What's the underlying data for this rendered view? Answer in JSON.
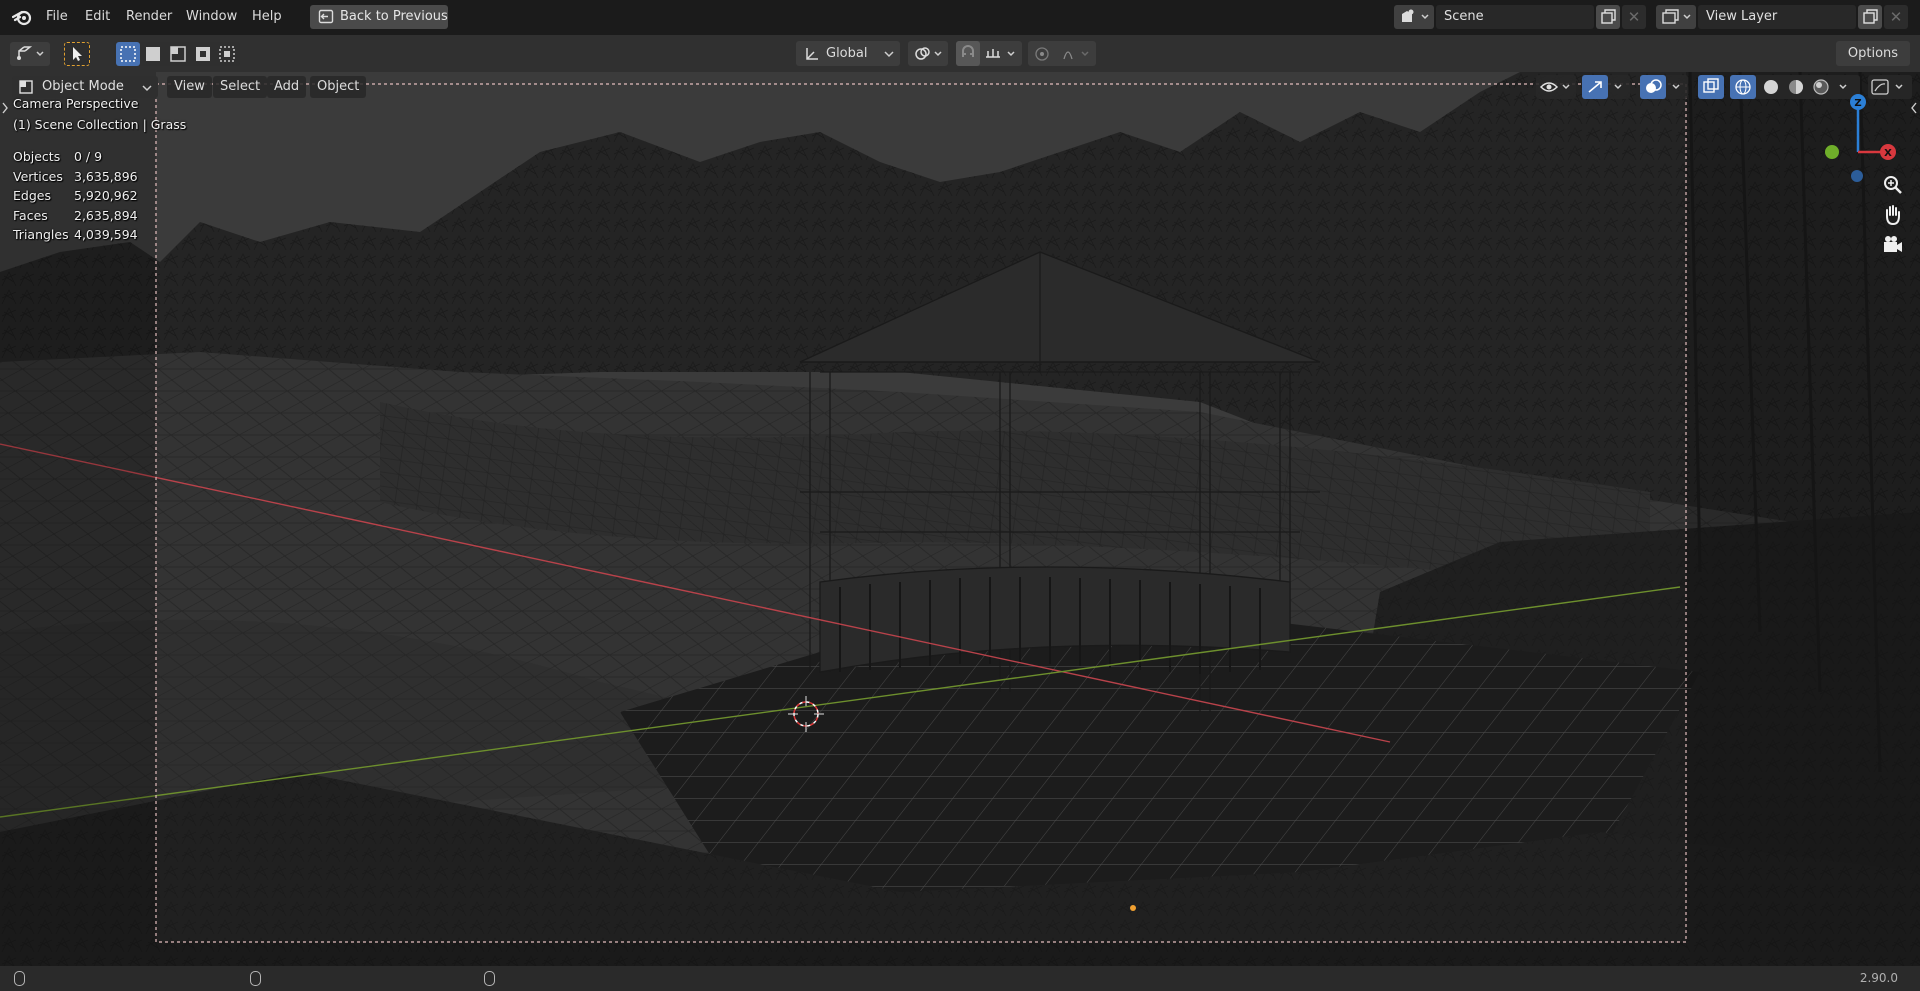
{
  "menubar": {
    "items": [
      "File",
      "Edit",
      "Render",
      "Window",
      "Help"
    ],
    "back_button": "Back to Previous",
    "scene_name": "Scene",
    "view_layer_name": "View Layer"
  },
  "toolbar": {
    "orientation": "Global",
    "options_label": "Options"
  },
  "viewport": {
    "mode": "Object Mode",
    "menus": [
      "View",
      "Select",
      "Add",
      "Object"
    ],
    "overlay_title": "Camera Perspective",
    "overlay_collection": "(1) Scene Collection | Grass",
    "stats": [
      {
        "label": "Objects",
        "value": "0 / 9"
      },
      {
        "label": "Vertices",
        "value": "3,635,896"
      },
      {
        "label": "Edges",
        "value": "5,920,962"
      },
      {
        "label": "Faces",
        "value": "2,635,894"
      },
      {
        "label": "Triangles",
        "value": "4,039,594"
      }
    ],
    "gizmo": {
      "z_label": "Z",
      "x_label": "X"
    }
  },
  "statusbar": {
    "version": "2.90.0"
  },
  "colors": {
    "x_axis": "#b8424a",
    "y_axis": "#6d8f2d",
    "gizmo_z": "#2b7fd6",
    "gizmo_x": "#d8383e",
    "gizmo_y": "#6fae2a",
    "camera_frame": "#e3bdbd",
    "active_blue": "#4772b3"
  }
}
